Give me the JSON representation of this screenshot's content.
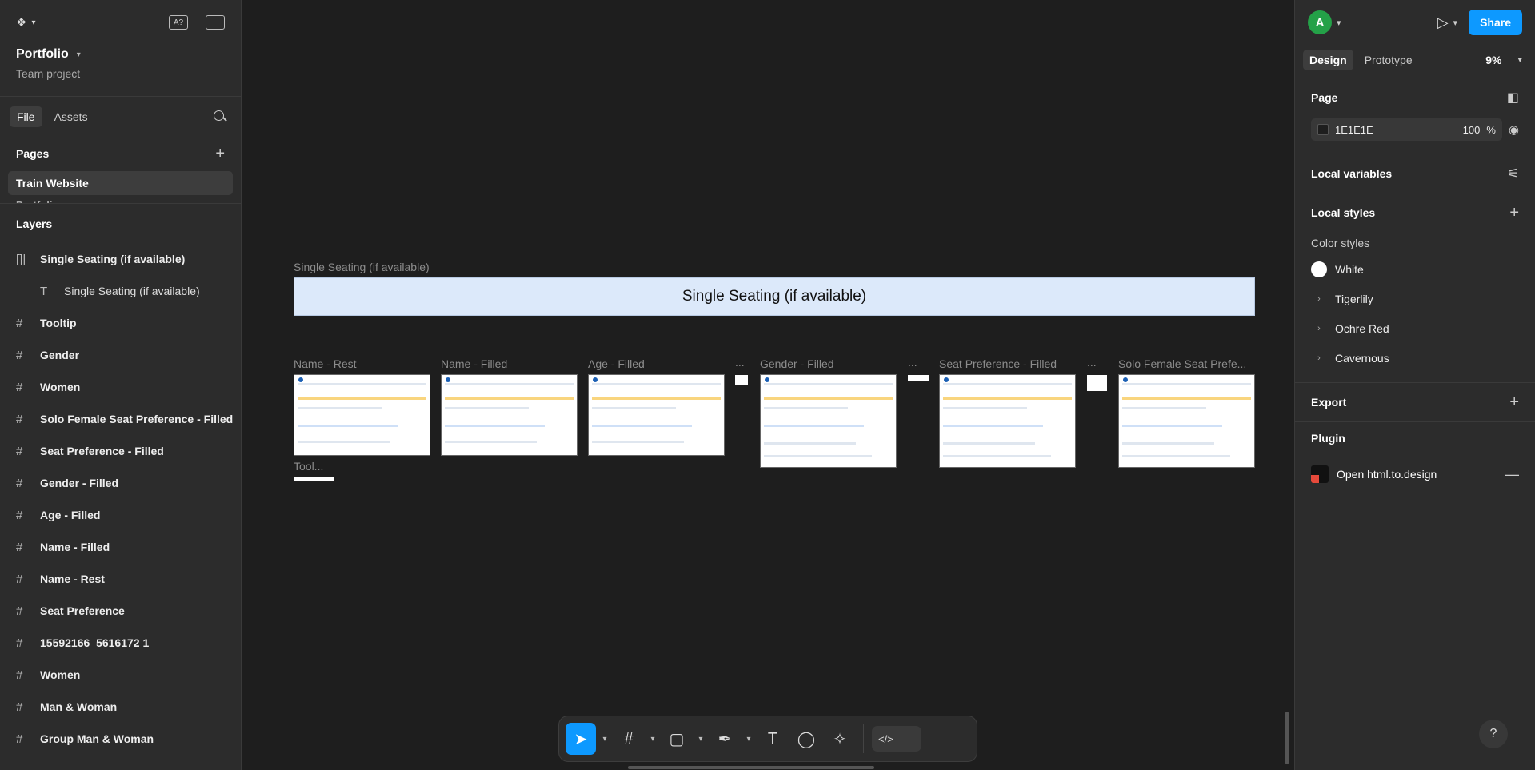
{
  "left": {
    "project_name": "Portfolio",
    "project_sub": "Team project",
    "tabs": [
      "File",
      "Assets"
    ],
    "pages_heading": "Pages",
    "pages": [
      "Train Website",
      "Portfolio"
    ],
    "layers_heading": "Layers",
    "layers": [
      {
        "icon": "auto-layout-icon",
        "label": "Single Seating (if available)"
      },
      {
        "icon": "text-icon",
        "label": "Single Seating (if available)"
      },
      {
        "icon": "frame-icon",
        "label": "Tooltip"
      },
      {
        "icon": "frame-icon",
        "label": "Gender"
      },
      {
        "icon": "frame-icon",
        "label": "Women"
      },
      {
        "icon": "frame-icon",
        "label": "Solo Female Seat Preference - Filled"
      },
      {
        "icon": "frame-icon",
        "label": "Seat Preference - Filled"
      },
      {
        "icon": "frame-icon",
        "label": "Gender - Filled"
      },
      {
        "icon": "frame-icon",
        "label": "Age - Filled"
      },
      {
        "icon": "frame-icon",
        "label": "Name - Filled"
      },
      {
        "icon": "frame-icon",
        "label": "Name - Rest"
      },
      {
        "icon": "frame-icon",
        "label": "Seat Preference"
      },
      {
        "icon": "frame-icon",
        "label": "15592166_5616172 1"
      },
      {
        "icon": "frame-icon",
        "label": "Women"
      },
      {
        "icon": "frame-icon",
        "label": "Man & Woman"
      },
      {
        "icon": "frame-icon",
        "label": "Group Man & Woman"
      }
    ]
  },
  "canvas": {
    "banner_label": "Single Seating (if available)",
    "banner_text": "Single Seating (if available)",
    "frames": [
      "Name - Rest",
      "Name - Filled",
      "Age - Filled",
      "...",
      "Gender - Filled",
      "...",
      "Seat Preference - Filled",
      "...",
      "Solo Female Seat Prefe...",
      "Tool..."
    ]
  },
  "toolbar": {
    "tools": [
      "move-tool",
      "frame-tool",
      "shape-tool",
      "pen-tool",
      "text-tool",
      "comment-tool",
      "actions-tool",
      "dev-mode-toggle"
    ]
  },
  "right": {
    "avatar_letter": "A",
    "share_label": "Share",
    "tabs": [
      "Design",
      "Prototype"
    ],
    "zoom": "9%",
    "page_heading": "Page",
    "page_color": "1E1E1E",
    "page_opacity": "100",
    "page_opacity_unit": "%",
    "local_variables": "Local variables",
    "local_styles": "Local styles",
    "color_styles_label": "Color styles",
    "color_styles": [
      "White",
      "Tigerlily",
      "Ochre Red",
      "Cavernous"
    ],
    "export_heading": "Export",
    "plugin_heading": "Plugin",
    "plugin_name": "Open html.to.design",
    "help": "?"
  }
}
